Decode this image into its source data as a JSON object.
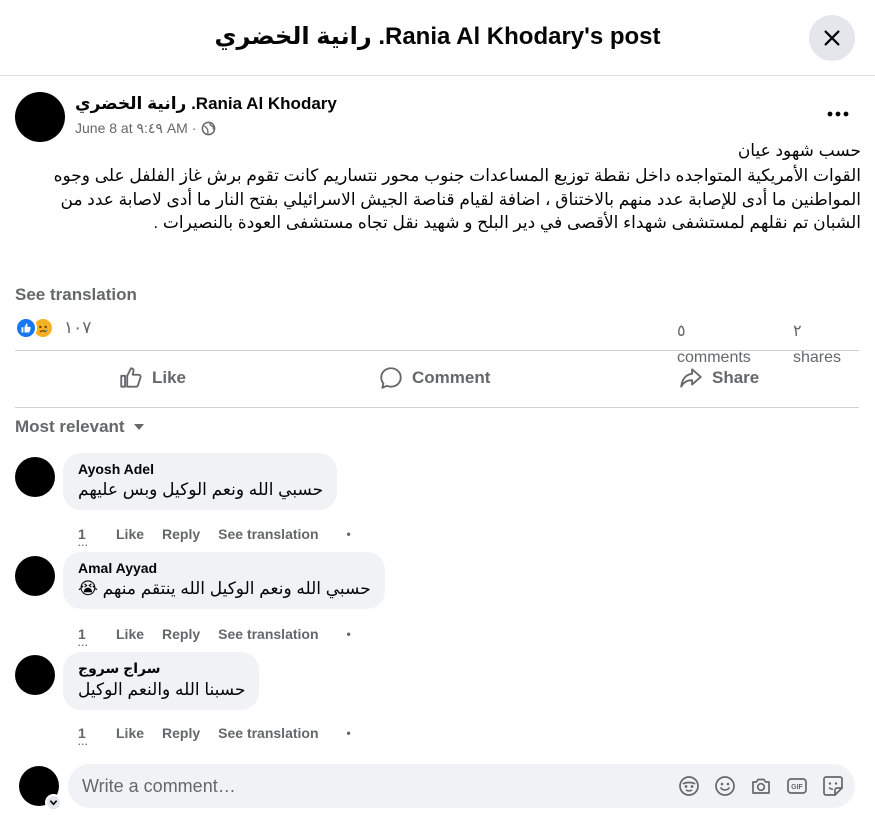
{
  "header": {
    "title": "رانية الخضري .Rania Al Khodary's post"
  },
  "post": {
    "author": "رانية الخضري .Rania Al Khodary",
    "date": "June 8 at ٩:٤٩ AM ·",
    "paragraphs": [
      "حسب شهود عيان",
      "القوات الأمريكية المتواجده داخل نقطة توزيع المساعدات جنوب محور نتساريم كانت تقوم برش غاز الفلفل على وجوه المواطنين ما أدى للإصابة عدد منهم بالاختناق ، اضافة لقيام قناصة الجيش الاسرائيلي بفتح النار ما أدى لاصابة عدد من الشبان تم نقلهم لمستشفى شهداء الأقصى في دير البلح و شهيد نقل تجاه مستشفى العودة بالنصيرات ."
    ],
    "see_translation": "See translation",
    "reaction_count": "١٠٧",
    "comments_count": "٥",
    "comments_label": "comments",
    "shares_count": "٢",
    "shares_label": "shares"
  },
  "actions": {
    "like": "Like",
    "comment": "Comment",
    "share": "Share"
  },
  "sort": {
    "label": "Most relevant"
  },
  "comments": [
    {
      "name": "Ayosh Adel",
      "text": "حسبي الله ونعم الوكيل وبس عليهم",
      "time": "1",
      "like": "Like",
      "reply": "Reply",
      "translate": "See translation"
    },
    {
      "name": "Amal Ayyad",
      "text": "حسبي الله ونعم الوكيل الله ينتقم منهم 😭",
      "time": "1",
      "like": "Like",
      "reply": "Reply",
      "translate": "See translation"
    },
    {
      "name": "سراج سروج",
      "text": "حسبنا الله والنعم الوكيل",
      "time": "1",
      "like": "Like",
      "reply": "Reply",
      "translate": "See translation"
    }
  ],
  "composer": {
    "placeholder": "Write a comment…"
  },
  "icons": {
    "close": "close-icon",
    "more": "more-horizontal-icon",
    "globe": "globe-icon",
    "like": "thumbs-up-icon",
    "comment": "speech-bubble-icon",
    "share": "share-arrow-icon",
    "caret": "caret-down-icon",
    "avatar_sticker": "avatar-sticker-icon",
    "emoji": "emoji-icon",
    "camera": "camera-icon",
    "gif": "gif-icon",
    "sticker": "sticker-icon"
  },
  "colors": {
    "like_blue": "#1877f2",
    "sad_yellow": "#f7b125",
    "secondary_text": "#65676b",
    "bubble_bg": "#f0f2f5"
  }
}
